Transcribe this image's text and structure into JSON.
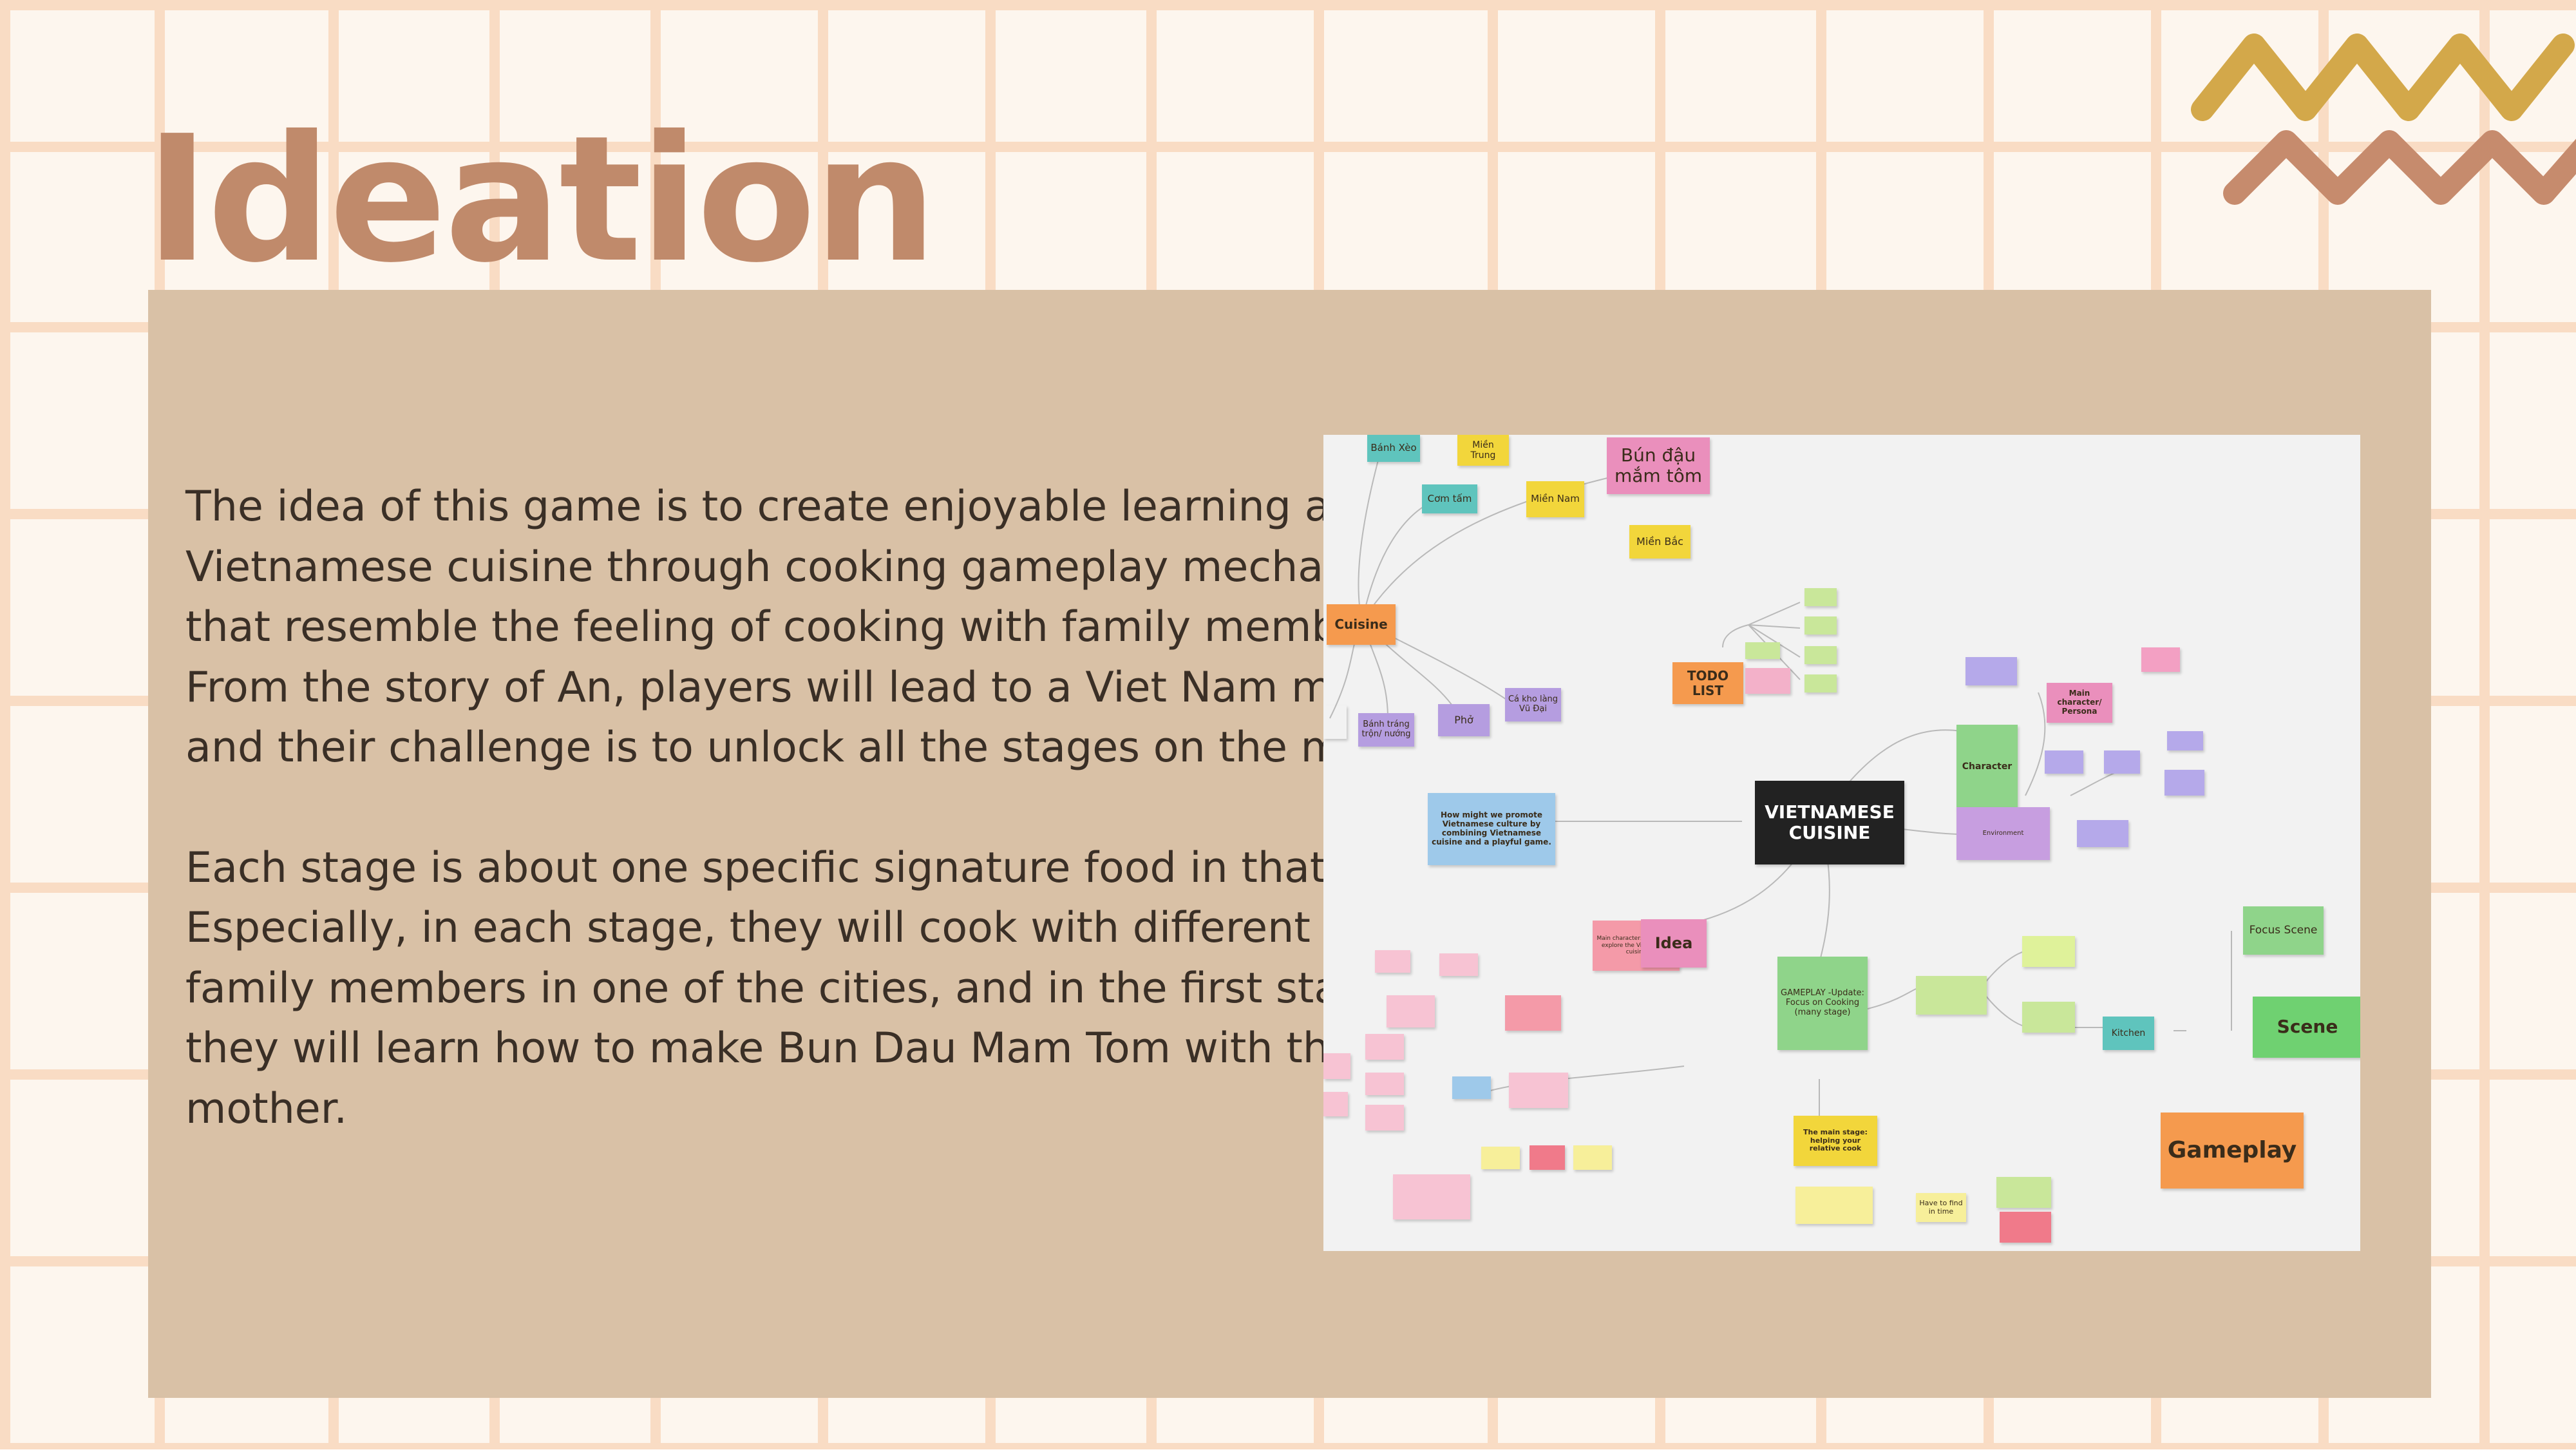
{
  "page": {
    "title": "Ideation",
    "paragraphs": [
      "The idea of this game is to create enjoyable learning about Vietnamese cuisine through cooking gameplay mechanics that resemble the feeling of cooking with family members. From the story of An, players will lead to a Viet Nam map and their challenge is to unlock all the stages on the map.",
      "Each stage is about one specific signature food in that city. Especially, in each stage, they will cook with different family members in one of the cities, and in the first stage, they will learn how to make Bun Dau Mam Tom with their mother."
    ]
  },
  "colors": {
    "background": "#fdf6ee",
    "grid_line": "#f9dcc4",
    "title": "#c08a6b",
    "panel": "#d9c1a6",
    "body_text": "#3a2f26",
    "zigzag_top": "#d3a84a",
    "zigzag_bottom": "#c68b6d",
    "board": "#f2f2f2"
  },
  "mindmap": {
    "notes": [
      {
        "text": "Bánh Xèo",
        "color": "#5fc4bd"
      },
      {
        "text": "Miền Trung",
        "color": "#f2d63b"
      },
      {
        "text": "Cơm tấm",
        "color": "#5fc4bd"
      },
      {
        "text": "Miền Nam",
        "color": "#f2d63b"
      },
      {
        "text": "Bún đậu mắm tôm",
        "color": "#ea8fbc"
      },
      {
        "text": "Miền Bắc",
        "color": "#f2d63b"
      },
      {
        "text": "Cuisine",
        "color": "#f59a4e"
      },
      {
        "text": "Bánh tráng trộn/ nướng",
        "color": "#b59de0"
      },
      {
        "text": "Phở",
        "color": "#b59de0"
      },
      {
        "text": "Cá kho làng Vũ Đại",
        "color": "#b59de0"
      },
      {
        "text": "TODO LIST",
        "color": "#f59a4e"
      },
      {
        "text": "VIETNAMESE CUISINE",
        "color": "#222222"
      },
      {
        "text": "How might we promote Vietnamese culture by combining Vietnamese cuisine and a playful game.",
        "color": "#9ec9ea"
      },
      {
        "text": "Character",
        "color": "#8fd48a"
      },
      {
        "text": "Environment",
        "color": "#c79ee0"
      },
      {
        "text": "Main character/ Persona",
        "color": "#ea8fbc"
      },
      {
        "text": "Idea",
        "color": "#ea8fbc"
      },
      {
        "text": "GAMEPLAY -Update: Focus on Cooking (many stage)",
        "color": "#8fd48a"
      },
      {
        "text": "Focus Scene",
        "color": "#8fd48a"
      },
      {
        "text": "Scene",
        "color": "#6fd171"
      },
      {
        "text": "Kitchen",
        "color": "#5fc4bd"
      },
      {
        "text": "Gameplay",
        "color": "#f59a4e"
      },
      {
        "text": "The main stage: helping your relative cook",
        "color": "#f2d63b"
      },
      {
        "text": "Have to find in time",
        "color": "#f7ef9a"
      },
      {
        "text": "Main character: Wanting to explore the Vietnamese cuisine",
        "color": "#f49aa8"
      }
    ]
  }
}
